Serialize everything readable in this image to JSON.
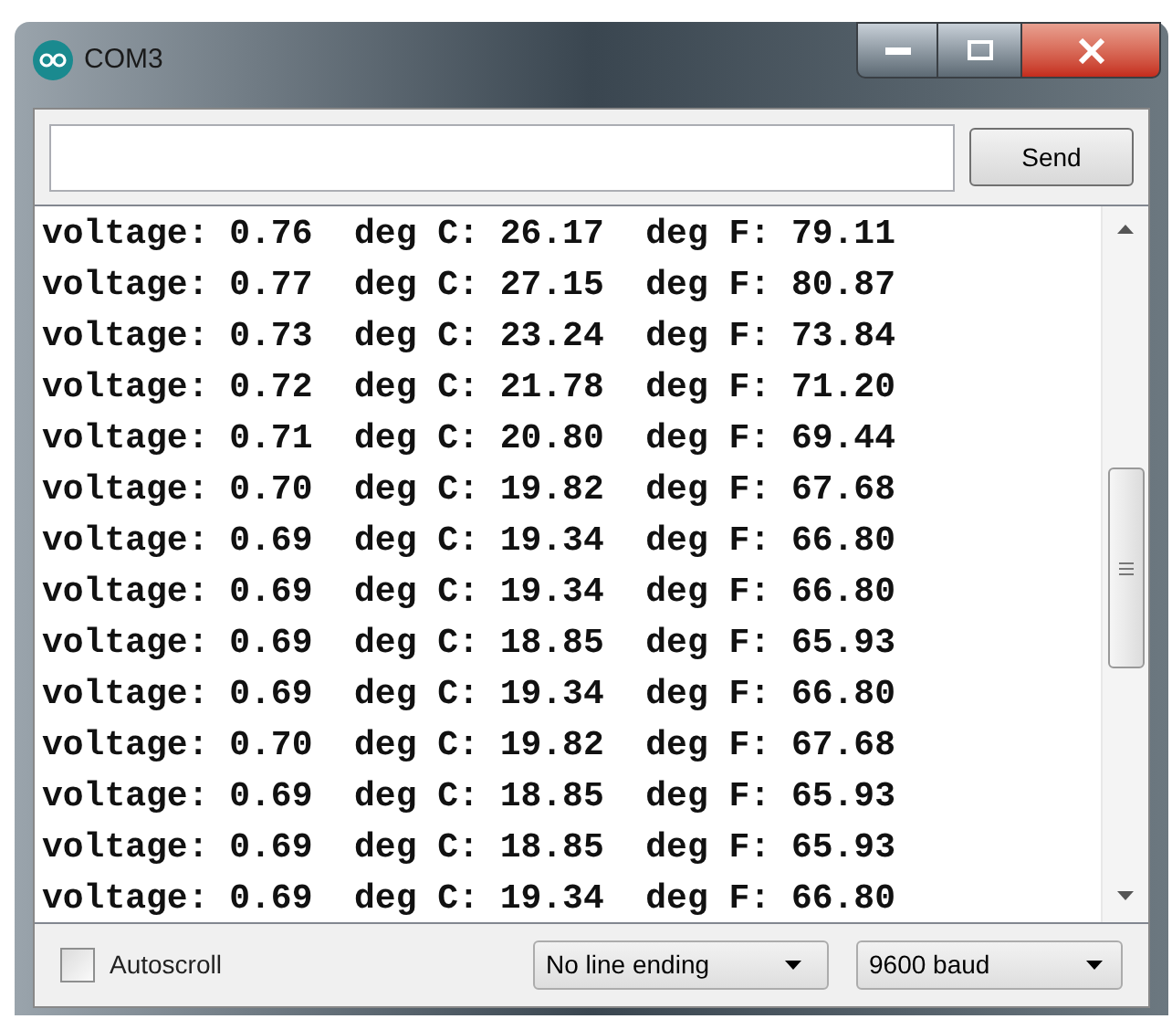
{
  "window": {
    "title": "COM3"
  },
  "send_button": "Send",
  "lines": [
    "voltage: 0.76  deg C: 26.17  deg F: 79.11",
    "voltage: 0.77  deg C: 27.15  deg F: 80.87",
    "voltage: 0.73  deg C: 23.24  deg F: 73.84",
    "voltage: 0.72  deg C: 21.78  deg F: 71.20",
    "voltage: 0.71  deg C: 20.80  deg F: 69.44",
    "voltage: 0.70  deg C: 19.82  deg F: 67.68",
    "voltage: 0.69  deg C: 19.34  deg F: 66.80",
    "voltage: 0.69  deg C: 19.34  deg F: 66.80",
    "voltage: 0.69  deg C: 18.85  deg F: 65.93",
    "voltage: 0.69  deg C: 19.34  deg F: 66.80",
    "voltage: 0.70  deg C: 19.82  deg F: 67.68",
    "voltage: 0.69  deg C: 18.85  deg F: 65.93",
    "voltage: 0.69  deg C: 18.85  deg F: 65.93",
    "voltage: 0.69  deg C: 19.34  deg F: 66.80"
  ],
  "autoscroll": {
    "label": "Autoscroll",
    "checked": false
  },
  "line_ending": "No line ending",
  "baud": "9600 baud"
}
